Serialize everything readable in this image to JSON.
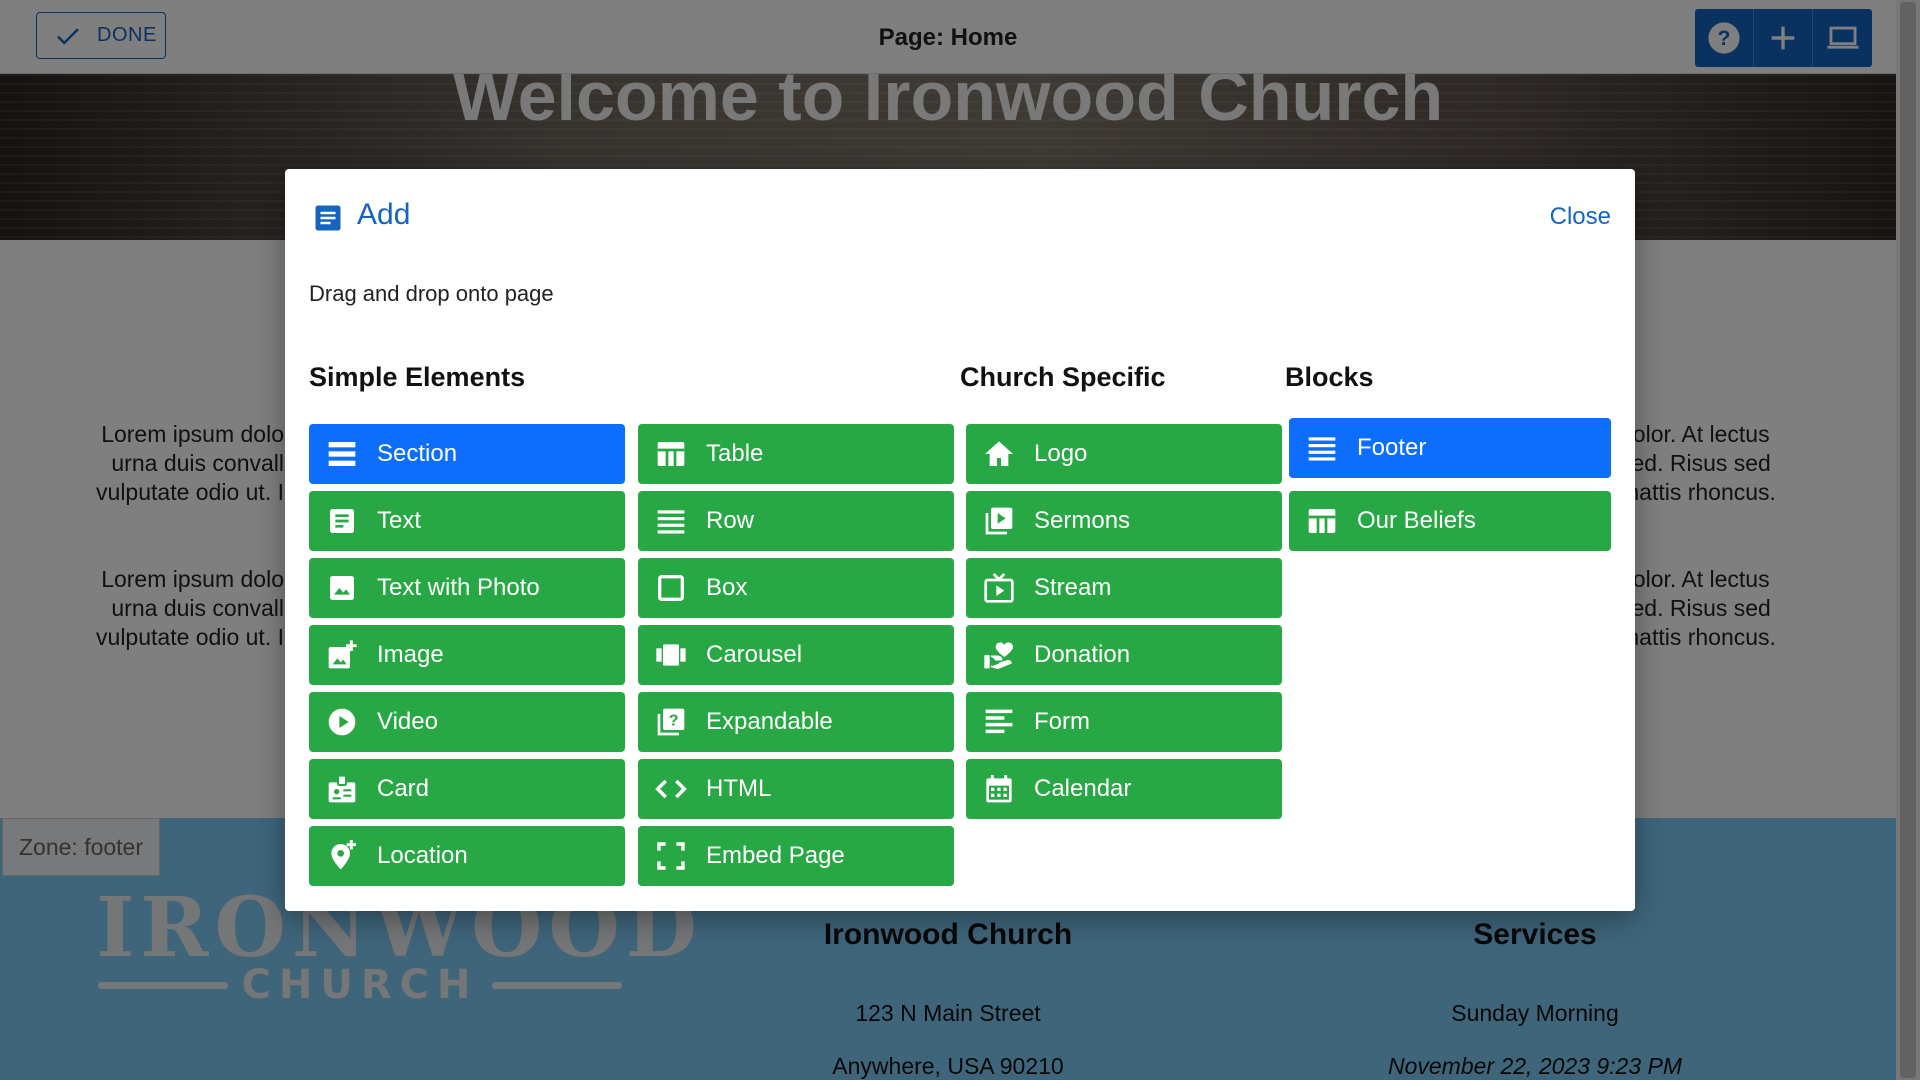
{
  "toolbar": {
    "done_label": "DONE",
    "page_label": "Page: Home",
    "tools": [
      "help-icon",
      "plus-icon",
      "laptop-icon"
    ]
  },
  "hero": {
    "title": "Welcome to Ironwood Church"
  },
  "body_text": {
    "left_1": [
      "Lorem ipsum dolo",
      "urna duis convall",
      "vulputate odio ut. I"
    ],
    "left_2": [
      "Lorem ipsum dolo",
      "urna duis convall",
      "vulputate odio ut. I"
    ],
    "right_1": [
      "dolor. At lectus",
      "sed. Risus sed",
      "mattis rhoncus."
    ],
    "right_2": [
      "dolor. At lectus",
      "sed. Risus sed",
      "mattis rhoncus."
    ]
  },
  "footer": {
    "zone_label": "Zone: footer",
    "logo_main": "IRONWOOD",
    "logo_sub": "CHURCH",
    "church_name": "Ironwood Church",
    "street": "123 N Main Street",
    "city": "Anywhere, USA 90210",
    "services_title": "Services",
    "services_time": "Sunday Morning",
    "services_date": "November 22, 2023 9:23 PM"
  },
  "dialog": {
    "title": "Add",
    "close_label": "Close",
    "instructions": "Drag and drop onto page",
    "headings": {
      "simple": "Simple Elements",
      "church": "Church Specific",
      "blocks": "Blocks"
    },
    "simple_col1": [
      {
        "label": "Section",
        "icon": "section-icon",
        "style": "blue"
      },
      {
        "label": "Text",
        "icon": "text-icon",
        "style": "green"
      },
      {
        "label": "Text with Photo",
        "icon": "photo-icon",
        "style": "green"
      },
      {
        "label": "Image",
        "icon": "add-photo-icon",
        "style": "green"
      },
      {
        "label": "Video",
        "icon": "play-circle-icon",
        "style": "green"
      },
      {
        "label": "Card",
        "icon": "badge-icon",
        "style": "green"
      },
      {
        "label": "Location",
        "icon": "add-location-icon",
        "style": "green"
      }
    ],
    "simple_col2": [
      {
        "label": "Table",
        "icon": "table-icon",
        "style": "green"
      },
      {
        "label": "Row",
        "icon": "row-icon",
        "style": "green"
      },
      {
        "label": "Box",
        "icon": "box-icon",
        "style": "green"
      },
      {
        "label": "Carousel",
        "icon": "carousel-icon",
        "style": "green"
      },
      {
        "label": "Expandable",
        "icon": "expandable-icon",
        "style": "green"
      },
      {
        "label": "HTML",
        "icon": "code-icon",
        "style": "green"
      },
      {
        "label": "Embed Page",
        "icon": "embed-icon",
        "style": "green"
      }
    ],
    "church_col": [
      {
        "label": "Logo",
        "icon": "home-icon",
        "style": "green"
      },
      {
        "label": "Sermons",
        "icon": "video-library-icon",
        "style": "green"
      },
      {
        "label": "Stream",
        "icon": "live-tv-icon",
        "style": "green"
      },
      {
        "label": "Donation",
        "icon": "volunteer-icon",
        "style": "green"
      },
      {
        "label": "Form",
        "icon": "form-icon",
        "style": "green"
      },
      {
        "label": "Calendar",
        "icon": "calendar-icon",
        "style": "green"
      }
    ],
    "blocks_col": [
      {
        "label": "Footer",
        "icon": "row-icon",
        "style": "blue"
      },
      {
        "label": "Our Beliefs",
        "icon": "table-icon",
        "style": "green"
      }
    ]
  },
  "colors": {
    "primary": "#1565c0",
    "green": "#28a745",
    "blue_button": "#0d6efd",
    "footer_bg": "#7fcaf7"
  }
}
